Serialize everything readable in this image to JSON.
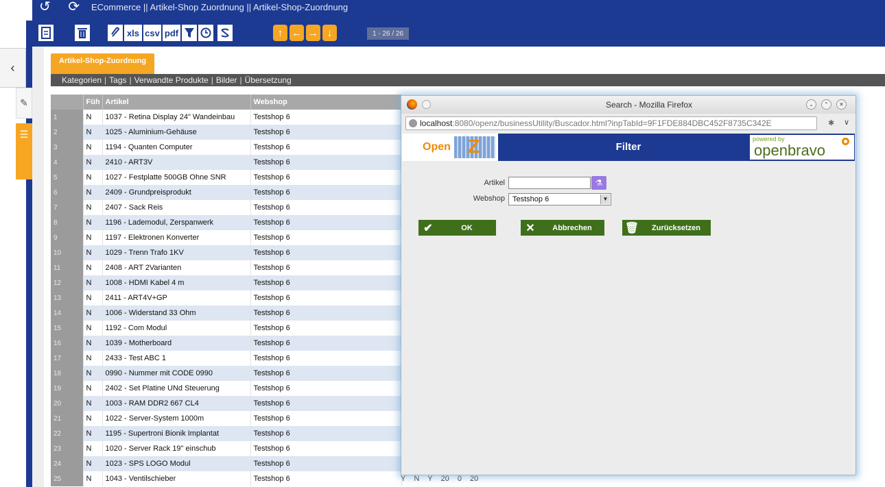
{
  "header": {
    "nav_glyphs": "↺ ⟳",
    "title": "ECommerce || Artikel-Shop Zuordnung  ||  Artikel-Shop-Zuordnung"
  },
  "toolbar": {
    "xls_label": "xls",
    "csv_label": "csv",
    "pdf_label": "pdf",
    "pager": "1 - 26 / 26"
  },
  "tabs": {
    "active": "Artikel-Shop-Zuordnung",
    "subtabs": [
      "Kategorien",
      "Tags",
      "Verwandte Produkte",
      "Bilder",
      "Übersetzung"
    ]
  },
  "grid": {
    "columns": [
      "",
      "Füh",
      "Artikel",
      "Webshop"
    ],
    "rows": [
      {
        "num": "1",
        "fuehr": "N",
        "artikel": "1037 - Retina Display 24\" Wandeinbau",
        "webshop": "Testshop 6"
      },
      {
        "num": "2",
        "fuehr": "N",
        "artikel": "1025 - Aluminium-Gehäuse",
        "webshop": "Testshop 6"
      },
      {
        "num": "3",
        "fuehr": "N",
        "artikel": "1194 - Quanten Computer",
        "webshop": "Testshop 6"
      },
      {
        "num": "4",
        "fuehr": "N",
        "artikel": "2410 - ART3V",
        "webshop": "Testshop 6"
      },
      {
        "num": "5",
        "fuehr": "N",
        "artikel": "1027 - Festplatte 500GB Ohne SNR",
        "webshop": "Testshop 6"
      },
      {
        "num": "6",
        "fuehr": "N",
        "artikel": "2409 - Grundpreisprodukt",
        "webshop": "Testshop 6"
      },
      {
        "num": "7",
        "fuehr": "N",
        "artikel": "2407 - Sack Reis",
        "webshop": "Testshop 6"
      },
      {
        "num": "8",
        "fuehr": "N",
        "artikel": "1196 - Lademodul, Zerspanwerk",
        "webshop": "Testshop 6"
      },
      {
        "num": "9",
        "fuehr": "N",
        "artikel": "1197 - Elektronen Konverter",
        "webshop": "Testshop 6"
      },
      {
        "num": "10",
        "fuehr": "N",
        "artikel": "1029 - Trenn Trafo 1KV",
        "webshop": "Testshop 6"
      },
      {
        "num": "11",
        "fuehr": "N",
        "artikel": "2408 - ART 2Varianten",
        "webshop": "Testshop 6"
      },
      {
        "num": "12",
        "fuehr": "N",
        "artikel": "1008 - HDMI Kabel 4 m",
        "webshop": "Testshop 6"
      },
      {
        "num": "13",
        "fuehr": "N",
        "artikel": "2411 - ART4V+GP",
        "webshop": "Testshop 6"
      },
      {
        "num": "14",
        "fuehr": "N",
        "artikel": "1006 - Widerstand 33 Ohm",
        "webshop": "Testshop 6"
      },
      {
        "num": "15",
        "fuehr": "N",
        "artikel": "1192 - Com Modul",
        "webshop": "Testshop 6"
      },
      {
        "num": "16",
        "fuehr": "N",
        "artikel": "1039 - Motherboard",
        "webshop": "Testshop 6"
      },
      {
        "num": "17",
        "fuehr": "N",
        "artikel": "2433 - Test ABC 1",
        "webshop": "Testshop 6"
      },
      {
        "num": "18",
        "fuehr": "N",
        "artikel": "0990 - Nummer mit CODE 0990",
        "webshop": "Testshop 6"
      },
      {
        "num": "19",
        "fuehr": "N",
        "artikel": "2402 - Set Platine UNd Steuerung",
        "webshop": "Testshop 6"
      },
      {
        "num": "20",
        "fuehr": "N",
        "artikel": "1003 - RAM DDR2 667 CL4",
        "webshop": "Testshop 6"
      },
      {
        "num": "21",
        "fuehr": "N",
        "artikel": "1022 - Server-System 1000m",
        "webshop": "Testshop 6"
      },
      {
        "num": "22",
        "fuehr": "N",
        "artikel": "1195 - Supertroni Bionik Implantat",
        "webshop": "Testshop 6"
      },
      {
        "num": "23",
        "fuehr": "N",
        "artikel": "1020 - Server Rack 19\" einschub",
        "webshop": "Testshop 6"
      },
      {
        "num": "24",
        "fuehr": "N",
        "artikel": "1023 - SPS LOGO Modul",
        "webshop": "Testshop 6"
      },
      {
        "num": "25",
        "fuehr": "N",
        "artikel": "1043 - Ventilschieber",
        "webshop": "Testshop 6"
      }
    ],
    "row25_extra": [
      "Y",
      "N",
      "Y",
      "20",
      "0",
      "20"
    ]
  },
  "popup": {
    "title": "Search - Mozilla Firefox",
    "url_host": "localhost",
    "url_rest": ":8080/openz/businessUtility/Buscador.html?inpTabId=9F1FDE884DBC452F8735C342E",
    "banner_title": "Filter",
    "logo_text": "Open",
    "logo_letter": "Z",
    "powered_by": "powered by",
    "brand": "openbravo",
    "form": {
      "artikel_label": "Artikel",
      "artikel_value": "",
      "webshop_label": "Webshop",
      "webshop_value": "Testshop 6"
    },
    "buttons": {
      "ok": "OK",
      "cancel": "Abbrechen",
      "reset": "Zurücksetzen"
    }
  }
}
